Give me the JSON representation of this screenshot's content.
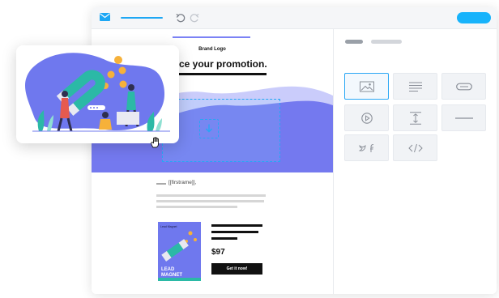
{
  "toolbar": {
    "mail_icon": "mail-icon",
    "undo_icon": "undo-icon",
    "redo_icon": "redo-icon",
    "accent": "#17b3fb"
  },
  "email": {
    "brand_logo": "Brand Logo",
    "headline": "duce your promotion.",
    "merge_tag": "[[firstrame]],",
    "price": "$97",
    "cta_label": "Get it now!",
    "book_title_line1": "LEAD",
    "book_title_line2": "MAGNET",
    "book_top_text": "Lead Magnet",
    "drop_icon": "download-icon"
  },
  "panel": {
    "tiles": [
      {
        "name": "image-block",
        "icon": "image-icon"
      },
      {
        "name": "text-block",
        "icon": "text-icon"
      },
      {
        "name": "button-block",
        "icon": "button-icon"
      },
      {
        "name": "video-block",
        "icon": "play-icon"
      },
      {
        "name": "spacer-block",
        "icon": "spacer-icon"
      },
      {
        "name": "divider-block",
        "icon": "divider-icon"
      },
      {
        "name": "social-block",
        "icon": "social-icon"
      },
      {
        "name": "html-block",
        "icon": "code-icon"
      }
    ]
  },
  "colors": {
    "wave_primary": "#7479ef",
    "wave_light": "#9ea3f7",
    "brand_blue": "#29a7f5"
  }
}
